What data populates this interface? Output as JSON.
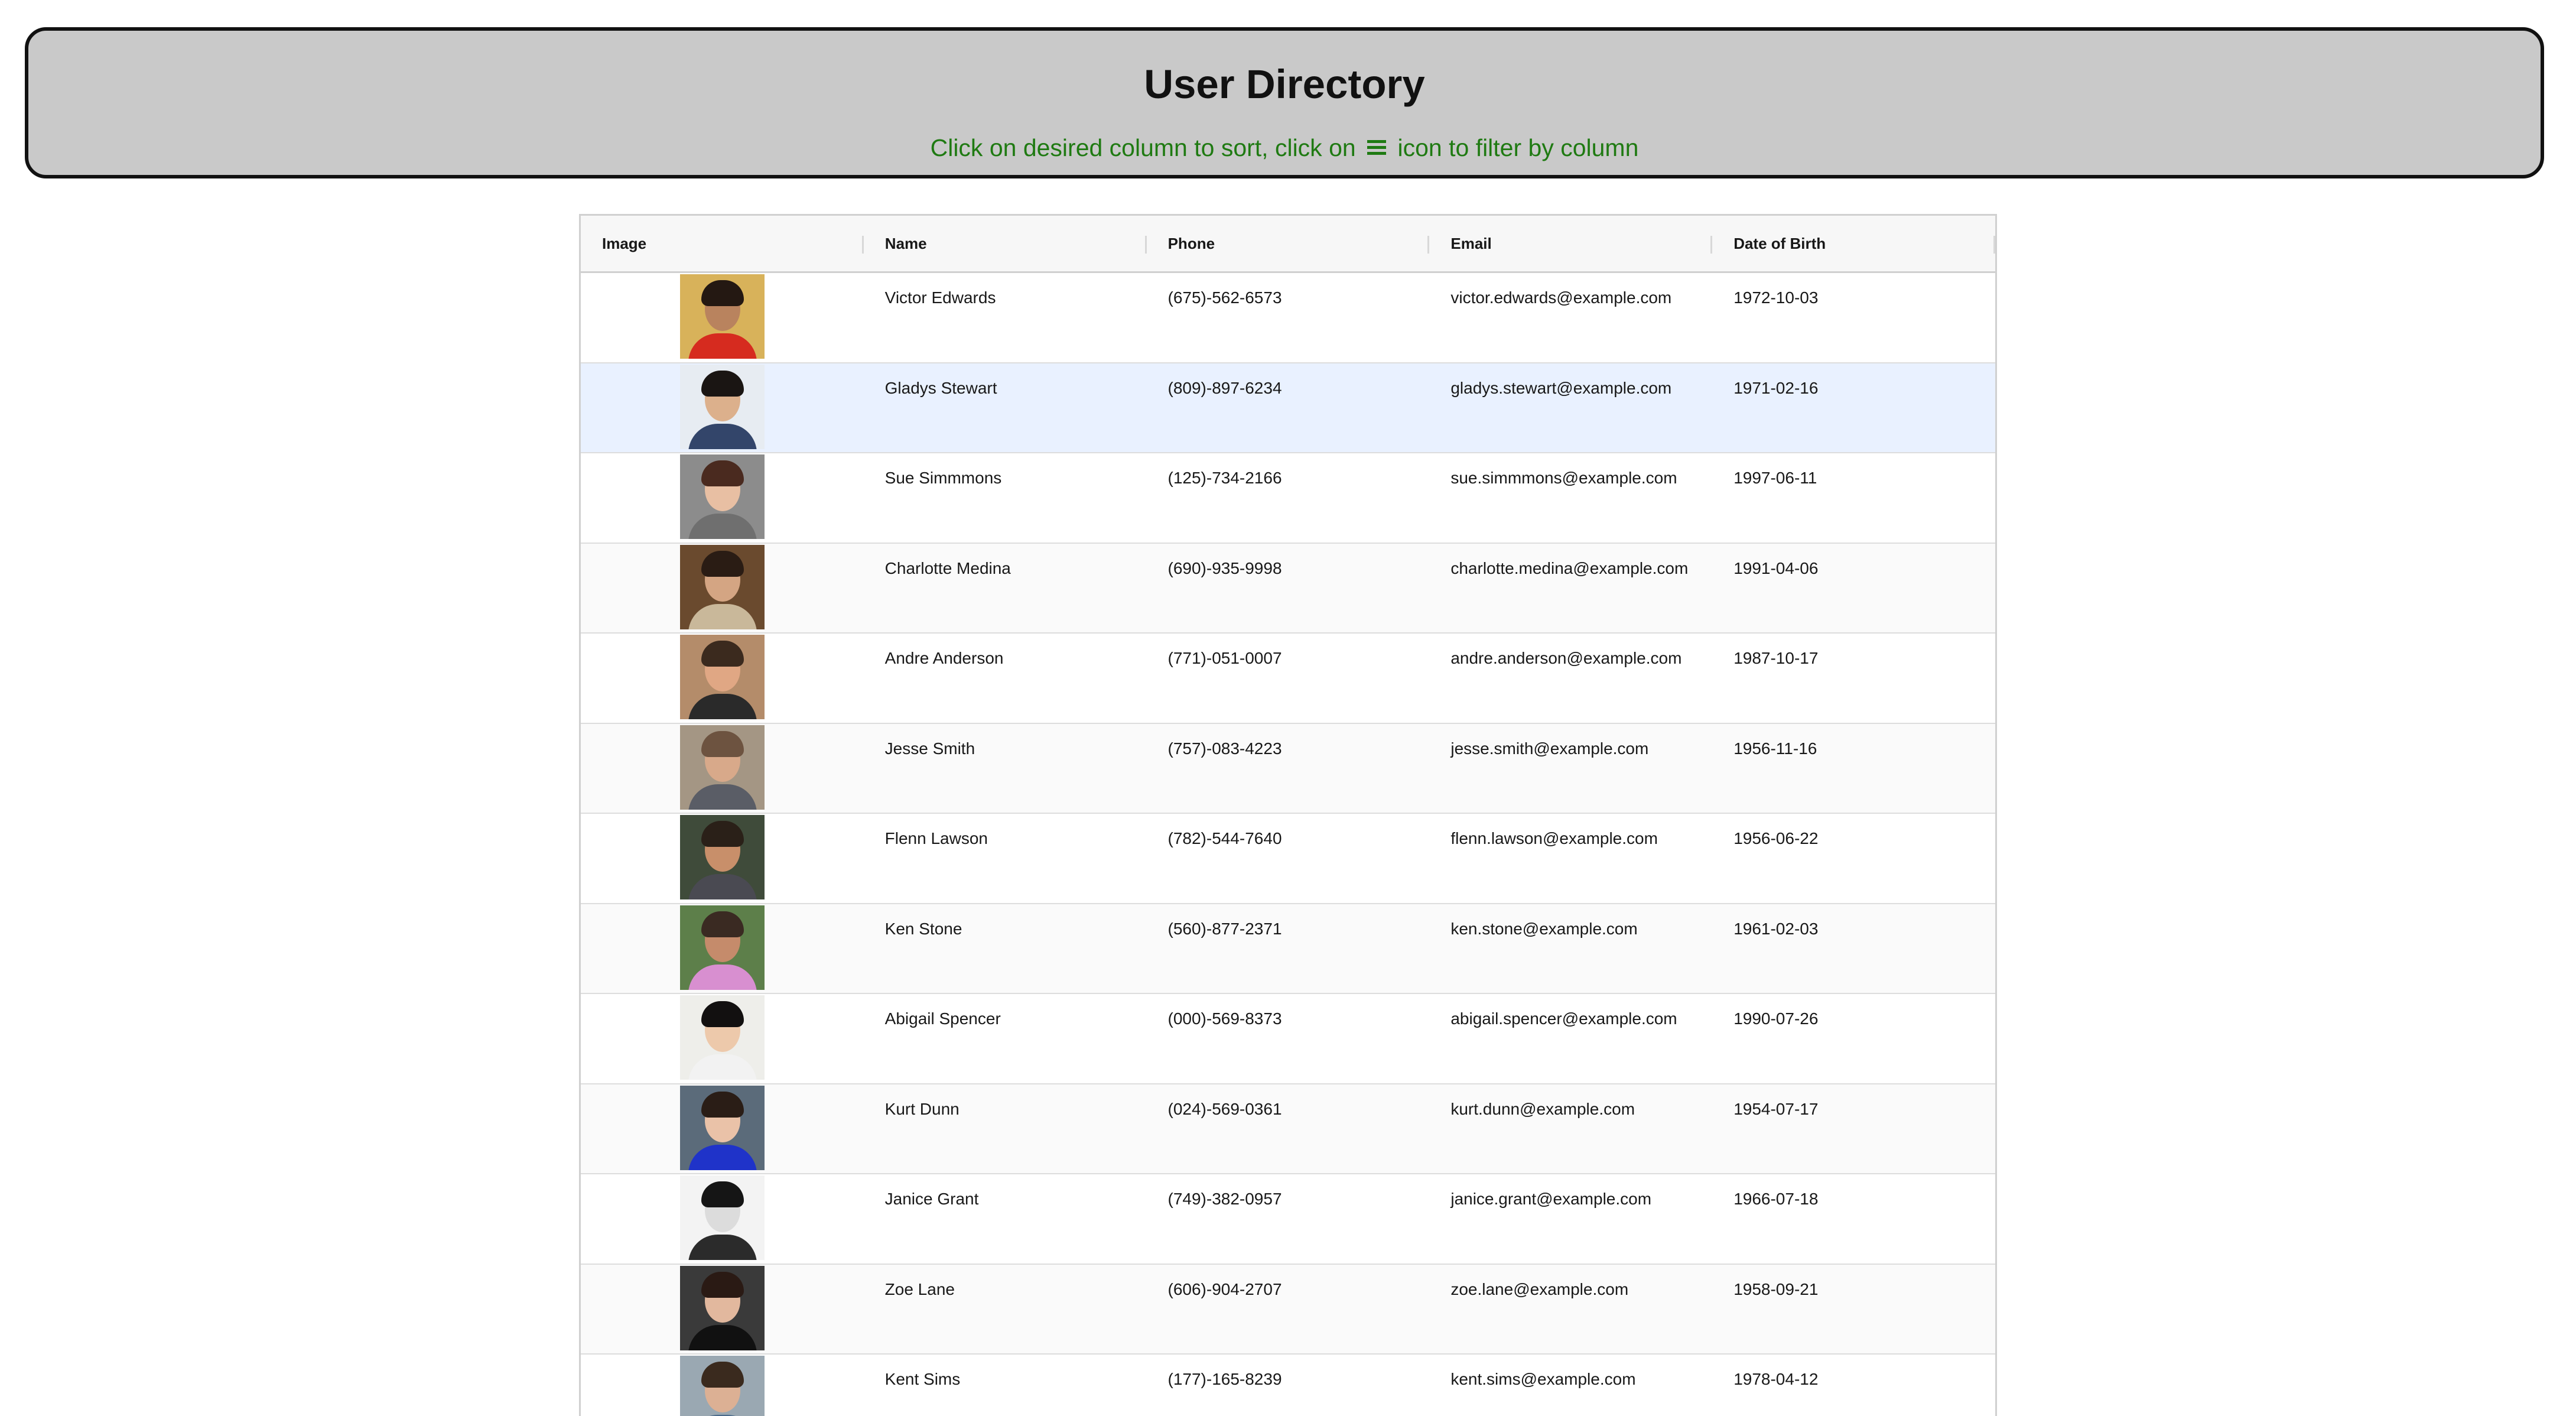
{
  "header": {
    "title": "User Directory",
    "instruction_before": "Click on desired column to sort, click on",
    "instruction_icon": "menu-icon",
    "instruction_after": "icon to filter by column",
    "instruction_color": "#1f7a12"
  },
  "table": {
    "columns": [
      "Image",
      "Name",
      "Phone",
      "Email",
      "Date of Birth"
    ],
    "selected_row": 1,
    "rows": [
      {
        "name": "Victor Edwards",
        "phone": "(675)-562-6573",
        "email": "victor.edwards@example.com",
        "dob": "1972-10-03",
        "photo": {
          "bg": "#d8b25a",
          "skin": "#b9835e",
          "hair": "#241812",
          "shirt": "#d62b1f"
        }
      },
      {
        "name": "Gladys Stewart",
        "phone": "(809)-897-6234",
        "email": "gladys.stewart@example.com",
        "dob": "1971-02-16",
        "photo": {
          "bg": "#e7ecf2",
          "skin": "#dcb08c",
          "hair": "#1a1513",
          "shirt": "#33456a"
        }
      },
      {
        "name": "Sue Simmmons",
        "phone": "(125)-734-2166",
        "email": "sue.simmmons@example.com",
        "dob": "1997-06-11",
        "photo": {
          "bg": "#8c8c8c",
          "skin": "#e8bfa3",
          "hair": "#4a2a1f",
          "shirt": "#6f6f6f"
        }
      },
      {
        "name": "Charlotte Medina",
        "phone": "(690)-935-9998",
        "email": "charlotte.medina@example.com",
        "dob": "1991-04-06",
        "photo": {
          "bg": "#6a4a2e",
          "skin": "#d4a583",
          "hair": "#2a1c14",
          "shirt": "#c9b89a"
        }
      },
      {
        "name": "Andre Anderson",
        "phone": "(771)-051-0007",
        "email": "andre.anderson@example.com",
        "dob": "1987-10-17",
        "photo": {
          "bg": "#b48c6a",
          "skin": "#e0a784",
          "hair": "#3b2a1e",
          "shirt": "#2a2a2a"
        }
      },
      {
        "name": "Jesse Smith",
        "phone": "(757)-083-4223",
        "email": "jesse.smith@example.com",
        "dob": "1956-11-16",
        "photo": {
          "bg": "#a49684",
          "skin": "#d8a98a",
          "hair": "#6d5340",
          "shirt": "#5a5d66"
        }
      },
      {
        "name": "Flenn Lawson",
        "phone": "(782)-544-7640",
        "email": "flenn.lawson@example.com",
        "dob": "1956-06-22",
        "photo": {
          "bg": "#3f4b3a",
          "skin": "#c88f6a",
          "hair": "#2a2018",
          "shirt": "#4a4a52"
        }
      },
      {
        "name": "Ken Stone",
        "phone": "(560)-877-2371",
        "email": "ken.stone@example.com",
        "dob": "1961-02-03",
        "photo": {
          "bg": "#5d7f4a",
          "skin": "#c58b6b",
          "hair": "#3a2a22",
          "shirt": "#d88fd0"
        }
      },
      {
        "name": "Abigail Spencer",
        "phone": "(000)-569-8373",
        "email": "abigail.spencer@example.com",
        "dob": "1990-07-26",
        "photo": {
          "bg": "#eeeeea",
          "skin": "#edc9ab",
          "hair": "#121010",
          "shirt": "#f2f2f2"
        }
      },
      {
        "name": "Kurt Dunn",
        "phone": "(024)-569-0361",
        "email": "kurt.dunn@example.com",
        "dob": "1954-07-17",
        "photo": {
          "bg": "#5b6b7a",
          "skin": "#eac2a8",
          "hair": "#2a1d16",
          "shirt": "#1f33c9"
        }
      },
      {
        "name": "Janice Grant",
        "phone": "(749)-382-0957",
        "email": "janice.grant@example.com",
        "dob": "1966-07-18",
        "photo": {
          "bg": "#f3f3f3",
          "skin": "#dcdcdc",
          "hair": "#151515",
          "shirt": "#2b2b2b"
        }
      },
      {
        "name": "Zoe Lane",
        "phone": "(606)-904-2707",
        "email": "zoe.lane@example.com",
        "dob": "1958-09-21",
        "photo": {
          "bg": "#3a3a3a",
          "skin": "#e2b89e",
          "hair": "#2a1a14",
          "shirt": "#111111"
        }
      },
      {
        "name": "Kent Sims",
        "phone": "(177)-165-8239",
        "email": "kent.sims@example.com",
        "dob": "1978-04-12",
        "photo": {
          "bg": "#9aa8b2",
          "skin": "#dcb094",
          "hair": "#3a2a1e",
          "shirt": "#4a6a8a"
        }
      }
    ]
  }
}
